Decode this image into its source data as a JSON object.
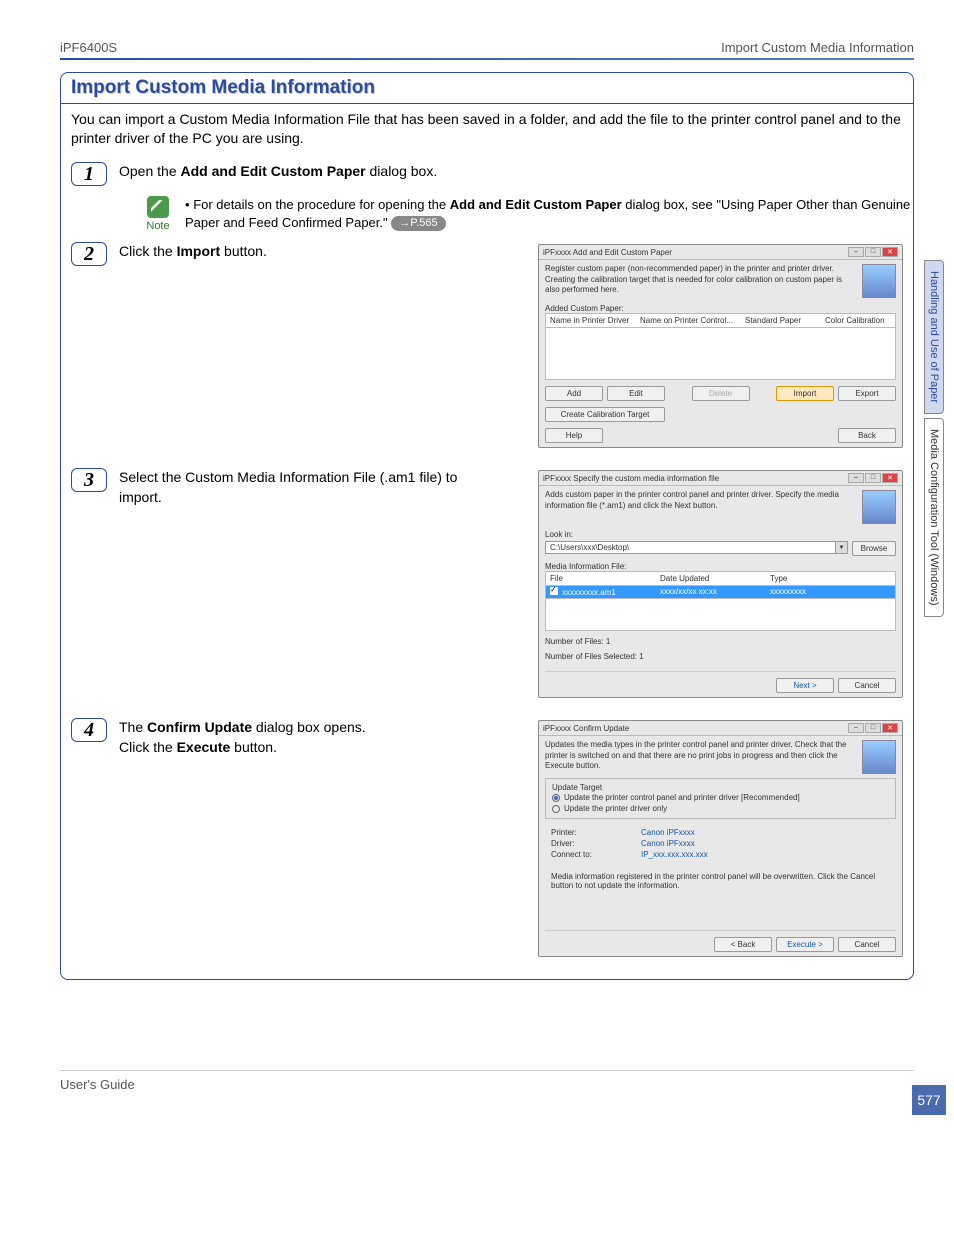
{
  "header": {
    "model": "iPF6400S",
    "topic": "Import Custom Media Information"
  },
  "title": "Import Custom Media Information",
  "intro": "You can import a Custom Media Information File that has been saved in a folder, and add the file to the printer control panel and to the printer driver of the PC you are using.",
  "steps": {
    "s1_prefix": "Open the ",
    "s1_bold": "Add and Edit Custom Paper",
    "s1_suffix": " dialog box.",
    "s2_prefix": "Click the ",
    "s2_bold": "Import",
    "s2_suffix": " button.",
    "s3": "Select the Custom Media Information File (.am1 file) to import.",
    "s4_line1_prefix": "The ",
    "s4_line1_bold": "Confirm Update",
    "s4_line1_suffix": " dialog box opens.",
    "s4_line2_prefix": "Click the ",
    "s4_line2_bold": "Execute",
    "s4_line2_suffix": " button."
  },
  "note": {
    "label": "Note",
    "bullet": "•",
    "text_prefix": "For details on the procedure for opening the ",
    "text_bold": "Add and Edit Custom Paper",
    "text_mid": " dialog box, see \"Using Paper Other than Genuine Paper and Feed Confirmed Paper.\" ",
    "page_ref": "→P.565"
  },
  "dialog1": {
    "title": "iPFxxxx Add and Edit Custom Paper",
    "desc": "Register custom paper (non-recommended paper) in the printer and printer driver. Creating the calibration target that is needed for color calibration on custom paper is also performed here.",
    "section": "Added Custom Paper:",
    "cols": [
      "Name in Printer Driver",
      "Name on Printer Control...",
      "Standard Paper",
      "Color Calibration"
    ],
    "btns": {
      "add": "Add",
      "edit": "Edit",
      "delete": "Delete",
      "import": "Import",
      "export": "Export",
      "calib": "Create Calibration Target",
      "help": "Help",
      "back": "Back"
    }
  },
  "dialog2": {
    "title": "iPFxxxx Specify the custom media information file",
    "desc": "Adds custom paper in the printer control panel and printer driver. Specify the media information file (*.am1) and click the Next button.",
    "lookin_label": "Look in:",
    "lookin_value": "C:\\Users\\xxx\\Desktop\\",
    "browse": "Browse",
    "mif_label": "Media Information File:",
    "cols": [
      "File",
      "Date Updated",
      "Type"
    ],
    "row": [
      "xxxxxxxxx.am1",
      "xxxx/xx/xx xx:xx",
      "xxxxxxxxx"
    ],
    "num_files": "Number of Files: 1",
    "num_selected": "Number of Files Selected: 1",
    "next": "Next >",
    "cancel": "Cancel"
  },
  "dialog3": {
    "title": "iPFxxxx Confirm Update",
    "desc": "Updates the media types in the printer control panel and printer driver. Check that the printer is switched on and that there are no print jobs in progress and then click the Execute button.",
    "target_label": "Update Target",
    "opt1": "Update the printer control panel and printer driver [Recommended]",
    "opt2": "Update the printer driver only",
    "printer_l": "Printer:",
    "printer_v": "Canon iPFxxxx",
    "driver_l": "Driver:",
    "driver_v": "Canon iPFxxxx",
    "connect_l": "Connect to:",
    "connect_v": "IP_xxx.xxx.xxx.xxx",
    "warn": "Media information registered in the printer control panel will be overwritten. Click the Cancel button to not update the information.",
    "back": "< Back",
    "execute": "Execute >",
    "cancel": "Cancel"
  },
  "side": {
    "tab1": "Handling and Use of Paper",
    "tab2": "Media Configuration Tool (Windows)"
  },
  "page_number": "577",
  "footer": {
    "guide": "User's Guide"
  }
}
